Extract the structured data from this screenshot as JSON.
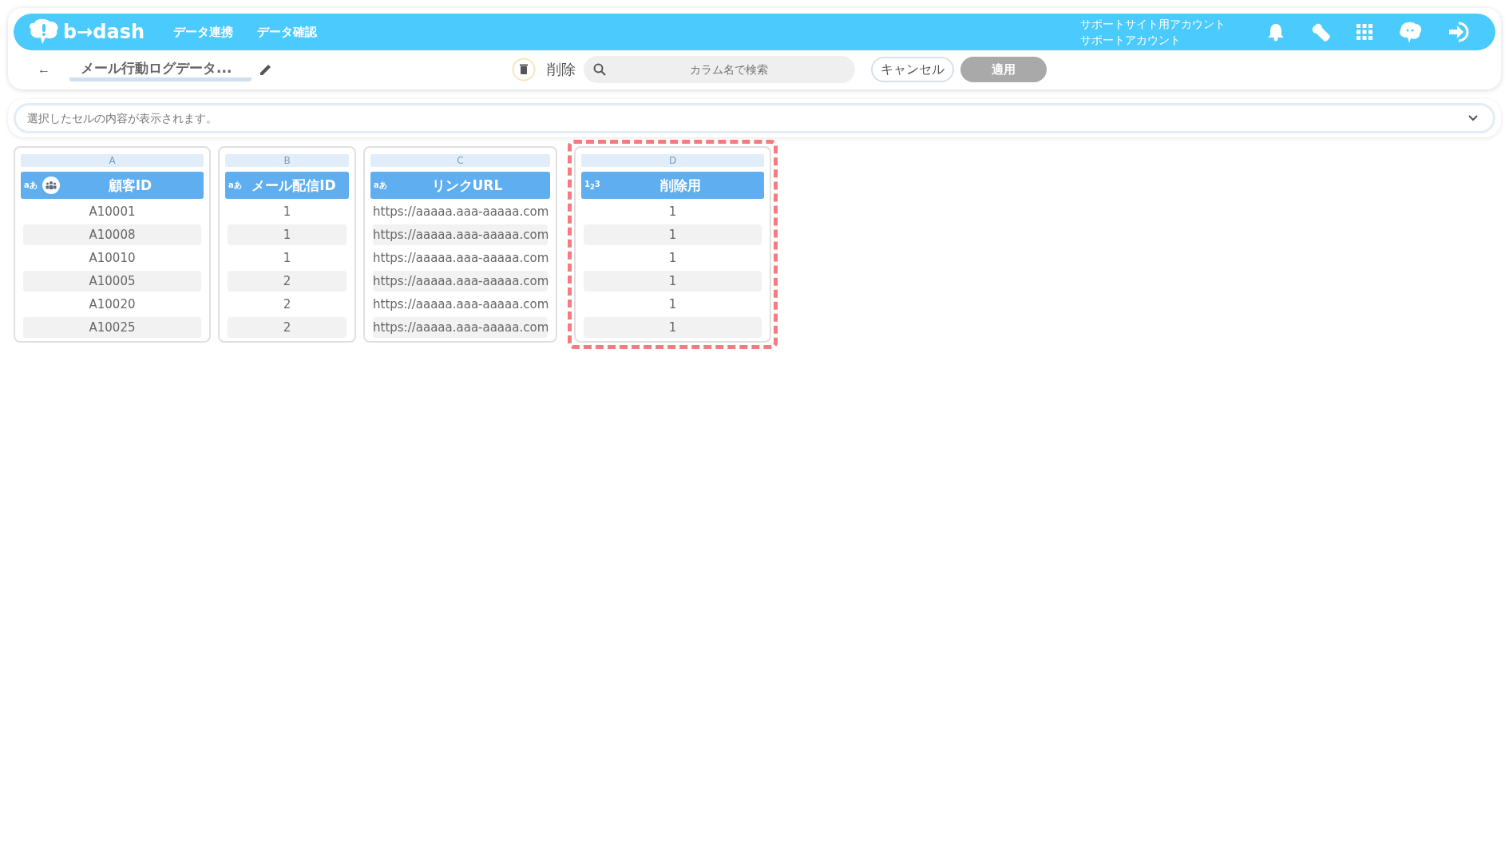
{
  "header": {
    "logo": "b→dash",
    "nav": [
      "データ連携",
      "データ確認"
    ],
    "account_lines": [
      "サポートサイト用アカウント",
      "サポートアカウント"
    ]
  },
  "toolbar": {
    "back": "←",
    "title": "メール行動ログデータ...",
    "delete_label": "削除",
    "search": {
      "placeholder": "カラム名で検索"
    },
    "cancel": "キャンセル",
    "apply": {
      "label": "適用",
      "disabled": true
    }
  },
  "cell_viewer": {
    "placeholder": "選択したセルの内容が表示されます。"
  },
  "columns": [
    {
      "letter": "A",
      "type_label": "aあ",
      "key": true,
      "name": "顧客ID",
      "highlighted": false,
      "cells": [
        "A10001",
        "A10008",
        "A10010",
        "A10005",
        "A10020",
        "A10025"
      ]
    },
    {
      "letter": "B",
      "type_label": "aあ",
      "key": false,
      "name": "メール配信ID",
      "highlighted": false,
      "cells": [
        "1",
        "1",
        "1",
        "2",
        "2",
        "2"
      ]
    },
    {
      "letter": "C",
      "type_label": "aあ",
      "key": false,
      "name": "リンクURL",
      "highlighted": false,
      "cells": [
        "https://aaaaa.aaa-aaaaa.com",
        "https://aaaaa.aaa-aaaaa.com",
        "https://aaaaa.aaa-aaaaa.com",
        "https://aaaaa.aaa-aaaaa.com",
        "https://aaaaa.aaa-aaaaa.com",
        "https://aaaaa.aaa-aaaaa.com"
      ]
    },
    {
      "letter": "D",
      "type_label": "1$_{2}$3",
      "key": false,
      "name": "削除用",
      "highlighted": true,
      "cells": [
        "1",
        "1",
        "1",
        "1",
        "1",
        "1"
      ]
    }
  ]
}
